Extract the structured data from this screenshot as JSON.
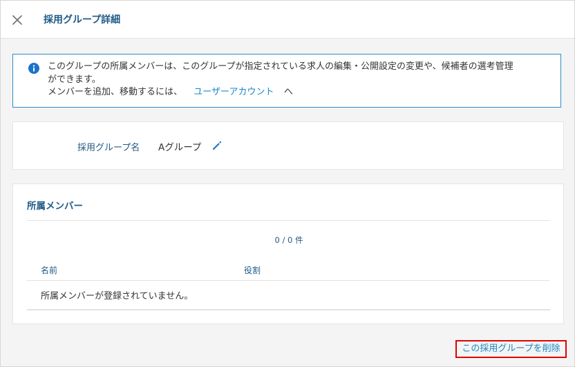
{
  "header": {
    "close_icon": "close-icon",
    "title": "採用グループ詳細"
  },
  "info": {
    "icon": "info-icon",
    "line1": "このグループの所属メンバーは、このグループが指定されている求人の編集・公開設定の変更や、候補者の選考管理",
    "line2": "ができます。",
    "line3_prefix": "メンバーを追加、移動するには、",
    "link_text": "ユーザーアカウント",
    "line3_suffix": "へ"
  },
  "group_name": {
    "label": "採用グループ名",
    "value": "Aグループ",
    "edit_icon": "pencil-icon"
  },
  "members": {
    "title": "所属メンバー",
    "count_text": "0 / 0 件",
    "columns": [
      "名前",
      "役割"
    ],
    "empty_message": "所属メンバーが登録されていません。"
  },
  "footer": {
    "delete_label": "この採用グループを削除"
  },
  "colors": {
    "accent": "#1f5a86",
    "link": "#1a86c6",
    "info_border": "#2a8bc6",
    "highlight": "#e00000"
  }
}
